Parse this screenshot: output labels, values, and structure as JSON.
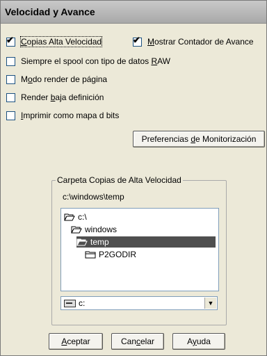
{
  "window": {
    "title": "Velocidad y Avance"
  },
  "options": {
    "copias_alta": {
      "label": "Copias Alta Velocidad",
      "checked": true
    },
    "mostrar_contador": {
      "label": "Mostrar Contador de Avance",
      "checked": true
    },
    "spool_raw": {
      "label": "Siempre el spool con tipo de datos RAW",
      "checked": false
    },
    "modo_render": {
      "label": "Modo render de página",
      "checked": false
    },
    "render_baja": {
      "label": "Render baja definición",
      "checked": false
    },
    "imprimir_mapa": {
      "label": "Imprimir como mapa d bits",
      "checked": false
    }
  },
  "buttons": {
    "preferencias": "Preferencias de Monitorización",
    "aceptar": "Aceptar",
    "cancelar": "Cancelar",
    "ayuda": "Ayuda"
  },
  "folder_group": {
    "label": "Carpeta Copias de Alta Velocidad",
    "path": "c:\\windows\\temp",
    "tree": [
      "c:\\",
      "windows",
      "temp",
      "P2GODIR"
    ],
    "selected": "temp",
    "drive": "c:"
  },
  "check_mark": "✔"
}
